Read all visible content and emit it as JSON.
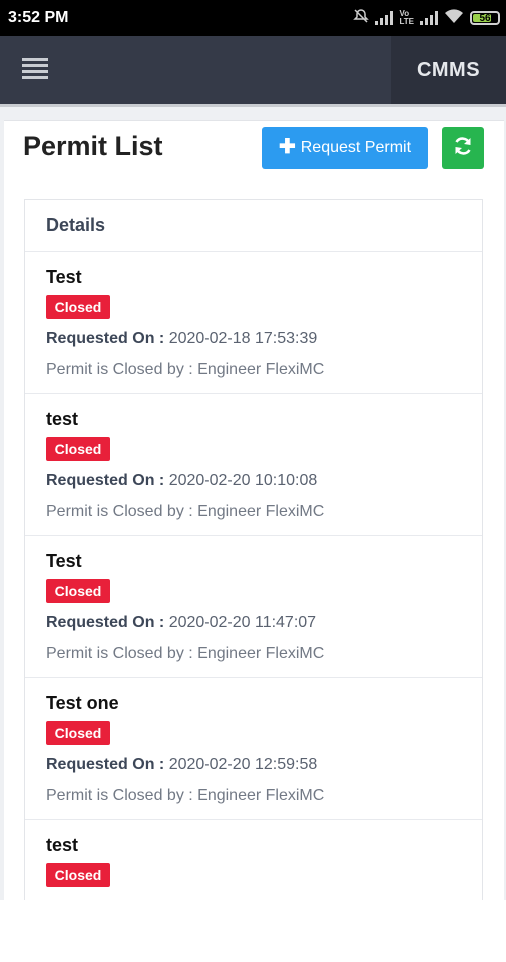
{
  "status_bar": {
    "time": "3:52 PM",
    "battery": "56"
  },
  "header": {
    "app_name": "CMMS"
  },
  "page": {
    "title": "Permit List",
    "request_button_label": "Request Permit"
  },
  "list": {
    "header": "Details",
    "requested_on_label": "Requested On :",
    "items": [
      {
        "name": "Test",
        "status": "Closed",
        "requested_on": "2020-02-18 17:53:39",
        "closed_by": "Permit is Closed by : Engineer FlexiMC"
      },
      {
        "name": "test",
        "status": "Closed",
        "requested_on": "2020-02-20 10:10:08",
        "closed_by": "Permit is Closed by : Engineer FlexiMC"
      },
      {
        "name": "Test",
        "status": "Closed",
        "requested_on": "2020-02-20 11:47:07",
        "closed_by": "Permit is Closed by : Engineer FlexiMC"
      },
      {
        "name": "Test one",
        "status": "Closed",
        "requested_on": "2020-02-20 12:59:58",
        "closed_by": "Permit is Closed by : Engineer FlexiMC"
      },
      {
        "name": "test",
        "status": "Closed"
      }
    ]
  },
  "colors": {
    "appbar": "#353a48",
    "primary_button": "#2c9bf0",
    "refresh_button": "#27b54f",
    "closed_badge": "#e8203a"
  },
  "icons": [
    "menu-icon",
    "plus-icon",
    "refresh-icon",
    "mute-icon",
    "signal-icon",
    "wifi-icon",
    "battery-icon"
  ]
}
